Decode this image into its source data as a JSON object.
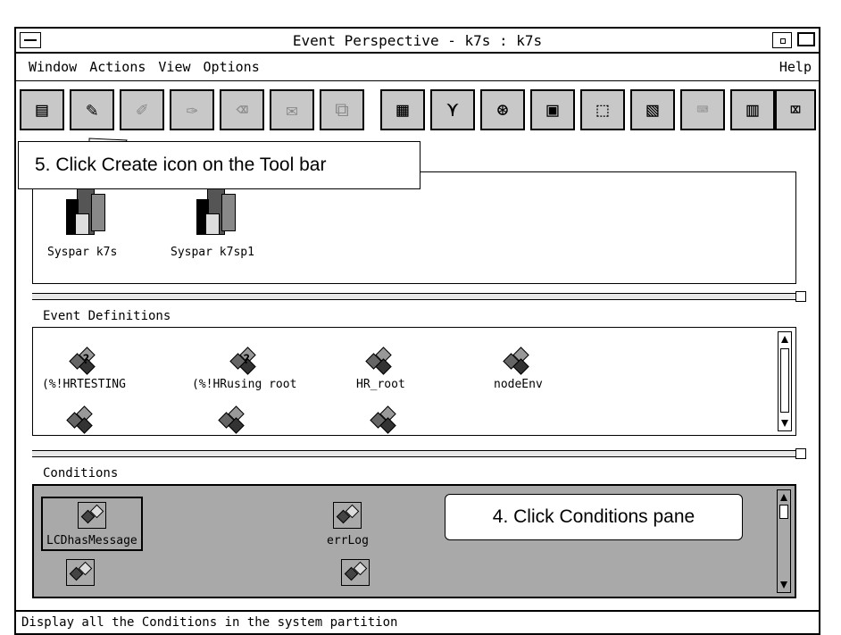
{
  "window": {
    "title": "Event Perspective - k7s : k7s"
  },
  "menubar": {
    "items": [
      "Window",
      "Actions",
      "View",
      "Options"
    ],
    "help": "Help"
  },
  "toolbar": {
    "tools": [
      {
        "icon": "open-icon",
        "enabled": true
      },
      {
        "icon": "create-icon",
        "enabled": true
      },
      {
        "icon": "edit-icon",
        "enabled": false
      },
      {
        "icon": "edit2-icon",
        "enabled": false
      },
      {
        "icon": "delete-icon",
        "enabled": false
      },
      {
        "icon": "register-icon",
        "enabled": false
      },
      {
        "icon": "copy-icon",
        "enabled": false
      },
      {
        "icon": "view-list-icon",
        "enabled": true
      },
      {
        "icon": "filter-icon",
        "enabled": true
      },
      {
        "icon": "find-icon",
        "enabled": true
      },
      {
        "icon": "select-all-icon",
        "enabled": true
      },
      {
        "icon": "deselect-icon",
        "enabled": true
      },
      {
        "icon": "refresh-icon",
        "enabled": true
      },
      {
        "icon": "notebook-icon",
        "enabled": false
      },
      {
        "icon": "console-icon",
        "enabled": true
      },
      {
        "icon": "terminal-icon",
        "enabled": true
      }
    ]
  },
  "syspar_pane": {
    "items": [
      "Syspar k7s",
      "Syspar k7sp1"
    ]
  },
  "event_definitions": {
    "title": "Event Definitions",
    "items": [
      "(%!HRTESTING",
      "(%!HRusing root",
      "HR_root",
      "nodeEnv"
    ]
  },
  "conditions": {
    "title": "Conditions",
    "items": [
      "LCDhasMessage",
      "errLog"
    ]
  },
  "status": "Display all the Conditions in the system partition",
  "callouts": {
    "create": "5. Click Create icon on the Tool bar",
    "conditions": "4. Click Conditions pane"
  }
}
